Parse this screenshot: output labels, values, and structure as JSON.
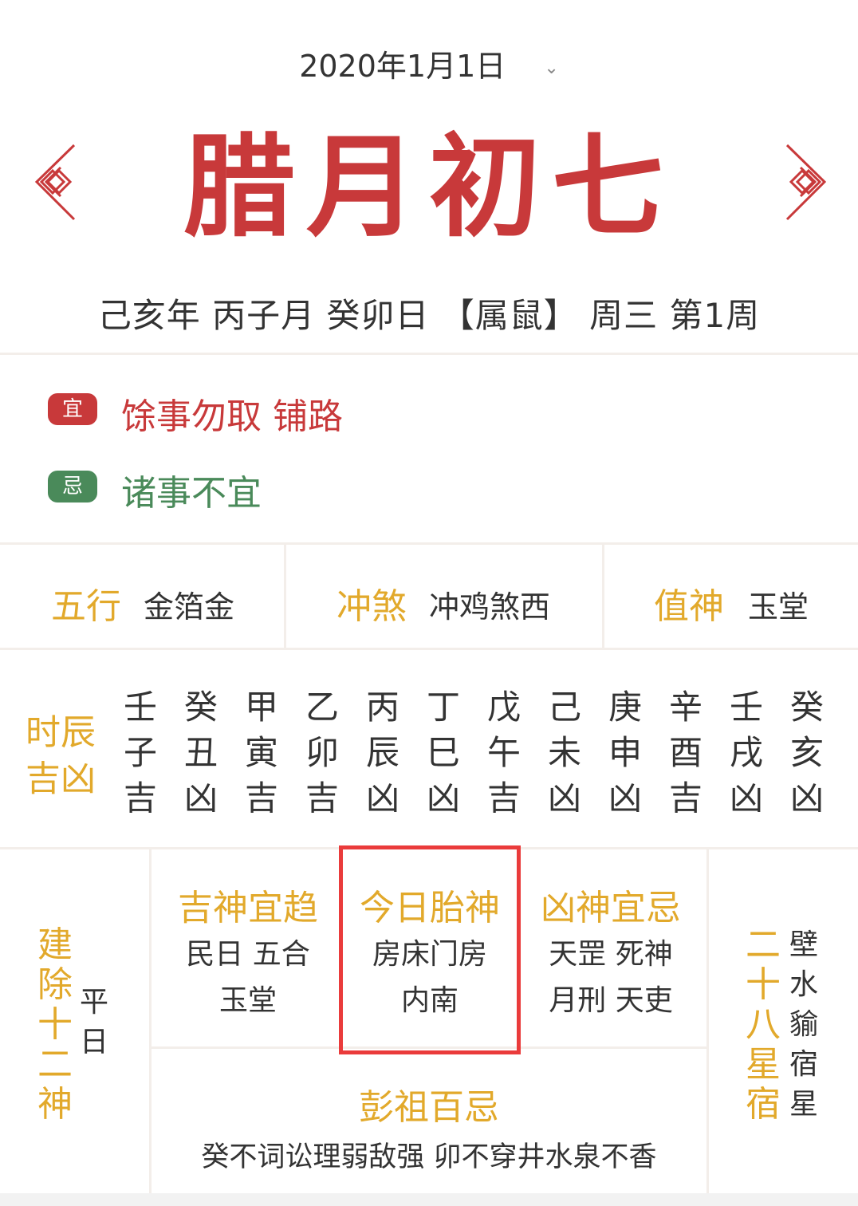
{
  "header": {
    "date": "2020年1月1日",
    "dropdown_icon": "chevron-down-icon",
    "lunar_date": "腊月初七",
    "ganzhi_line": "己亥年 丙子月 癸卯日 【属鼠】 周三 第1周",
    "accent_color": "#c8393a"
  },
  "yiji": {
    "yi_badge": "宜",
    "yi_text": "馀事勿取 铺路",
    "ji_badge": "忌",
    "ji_text": "诸事不宜",
    "yi_color": "#c8393a",
    "ji_color": "#4a8a5a"
  },
  "info": {
    "wuxing_key": "五行",
    "wuxing_val": "金箔金",
    "chongsha_key": "冲煞",
    "chongsha_val": "冲鸡煞西",
    "zhishen_key": "值神",
    "zhishen_val": "玉堂"
  },
  "hours": {
    "label_line1": "时辰",
    "label_line2": "吉凶",
    "items": [
      {
        "stem": "壬",
        "branch": "子",
        "luck": "吉"
      },
      {
        "stem": "癸",
        "branch": "丑",
        "luck": "凶"
      },
      {
        "stem": "甲",
        "branch": "寅",
        "luck": "吉"
      },
      {
        "stem": "乙",
        "branch": "卯",
        "luck": "吉"
      },
      {
        "stem": "丙",
        "branch": "辰",
        "luck": "凶"
      },
      {
        "stem": "丁",
        "branch": "巳",
        "luck": "凶"
      },
      {
        "stem": "戊",
        "branch": "午",
        "luck": "吉"
      },
      {
        "stem": "己",
        "branch": "未",
        "luck": "凶"
      },
      {
        "stem": "庚",
        "branch": "申",
        "luck": "凶"
      },
      {
        "stem": "辛",
        "branch": "酉",
        "luck": "吉"
      },
      {
        "stem": "壬",
        "branch": "戌",
        "luck": "凶"
      },
      {
        "stem": "癸",
        "branch": "亥",
        "luck": "凶"
      }
    ]
  },
  "jianchu": {
    "label_chars": [
      "建",
      "除",
      "十",
      "二",
      "神"
    ],
    "value_chars": [
      "平",
      "日"
    ]
  },
  "jishen": {
    "title": "吉神宜趋",
    "line1": "民日 五合",
    "line2": "玉堂"
  },
  "taishen": {
    "title": "今日胎神",
    "line1": "房床门房",
    "line2": "内南"
  },
  "xiongshen": {
    "title": "凶神宜忌",
    "line1": "天罡 死神",
    "line2": "月刑 天吏"
  },
  "pengzu": {
    "title": "彭祖百忌",
    "text": "癸不词讼理弱敌强 卯不穿井水泉不香"
  },
  "xingxiu": {
    "label_chars": [
      "二",
      "十",
      "八",
      "星",
      "宿"
    ],
    "value_chars": [
      "壁",
      "水",
      "貐",
      "宿",
      "星"
    ]
  }
}
